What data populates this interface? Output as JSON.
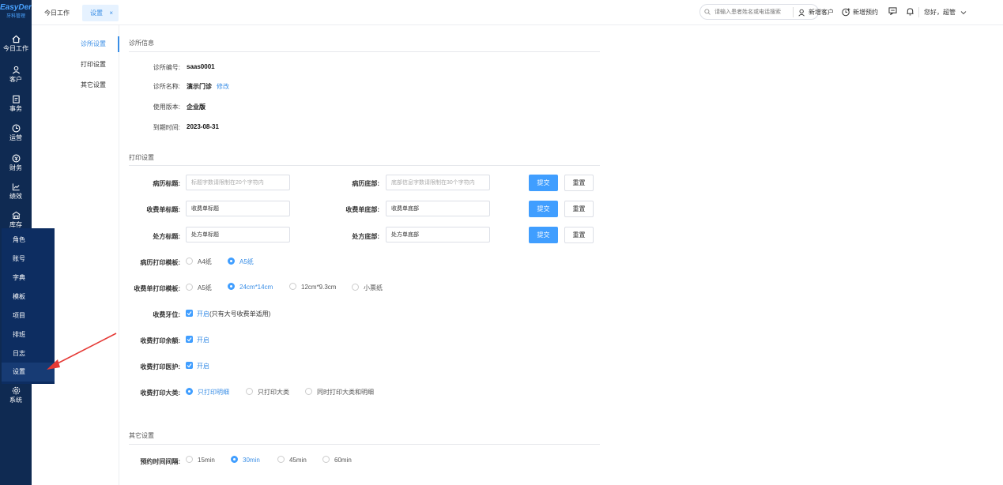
{
  "app": {
    "logo_line1": "EasyDent",
    "logo_line2": "牙科管理"
  },
  "sidebar": {
    "items": [
      {
        "label": "今日工作",
        "icon": "home-icon"
      },
      {
        "label": "客户",
        "icon": "user-icon"
      },
      {
        "label": "事务",
        "icon": "clipboard-icon"
      },
      {
        "label": "运营",
        "icon": "clock-icon"
      },
      {
        "label": "财务",
        "icon": "money-icon"
      },
      {
        "label": "绩效",
        "icon": "chart-icon"
      },
      {
        "label": "库存",
        "icon": "warehouse-icon"
      },
      {
        "label": "系统",
        "icon": "gear-icon"
      }
    ],
    "submenu": [
      "角色",
      "账号",
      "字典",
      "模板",
      "项目",
      "排班",
      "日志",
      "设置"
    ]
  },
  "topbar": {
    "tabs": [
      "今日工作",
      "设置"
    ],
    "search_placeholder": "请输入患者姓名或电话搜索",
    "new_customer": "新增客户",
    "new_appointment": "新增预约",
    "greeting": "您好，超管"
  },
  "subnav": [
    "诊所设置",
    "打印设置",
    "其它设置"
  ],
  "clinic_info": {
    "title": "诊所信息",
    "rows": [
      {
        "label": "诊所编号:",
        "value": "saas0001"
      },
      {
        "label": "诊所名称:",
        "value": "演示门诊",
        "link": "修改"
      },
      {
        "label": "使用版本:",
        "value": "企业版"
      },
      {
        "label": "到期时间:",
        "value": "2023-08-31"
      }
    ]
  },
  "print_settings": {
    "title": "打印设置",
    "rows": [
      {
        "left_label": "病历标题:",
        "left_placeholder": "标题字数请限制在20个字符内",
        "left_value": "",
        "right_label": "病历底部:",
        "right_placeholder": "底部信息字数请限制在30个字符内",
        "right_value": ""
      },
      {
        "left_label": "收费单标题:",
        "left_placeholder": "",
        "left_value": "收费单标题",
        "right_label": "收费单底部:",
        "right_placeholder": "",
        "right_value": "收费单底部"
      },
      {
        "left_label": "处方标题:",
        "left_placeholder": "",
        "left_value": "处方单标题",
        "right_label": "处方底部:",
        "right_placeholder": "",
        "right_value": "处方单底部"
      }
    ],
    "submit_label": "提交",
    "reset_label": "重置",
    "record_template": {
      "label": "病历打印模板:",
      "options": [
        "A4纸",
        "A5纸"
      ],
      "selected": "A5纸"
    },
    "receipt_template": {
      "label": "收费单打印模板:",
      "options": [
        "A5纸",
        "24cm*14cm",
        "12cm*9.3cm",
        "小票纸"
      ],
      "selected": "24cm*14cm"
    },
    "tooth_position": {
      "label": "收费牙位:",
      "check_label": "开启",
      "note": "(只有大号收费单适用)",
      "checked": true
    },
    "print_balance": {
      "label": "收费打印余额:",
      "check_label": "开启",
      "checked": true
    },
    "print_doctor": {
      "label": "收费打印医护:",
      "check_label": "开启",
      "checked": true
    },
    "print_category": {
      "label": "收费打印大类:",
      "options": [
        "只打印明细",
        "只打印大类",
        "同时打印大类和明细"
      ],
      "selected": "只打印明细"
    }
  },
  "other_settings": {
    "title": "其它设置",
    "interval": {
      "label": "预约时间间隔:",
      "options": [
        "15min",
        "30min",
        "45min",
        "60min"
      ],
      "selected": "30min"
    }
  },
  "colors": {
    "sidebar": "#0f2a52",
    "submenu": "#0d2d61",
    "accent": "#409eff"
  }
}
